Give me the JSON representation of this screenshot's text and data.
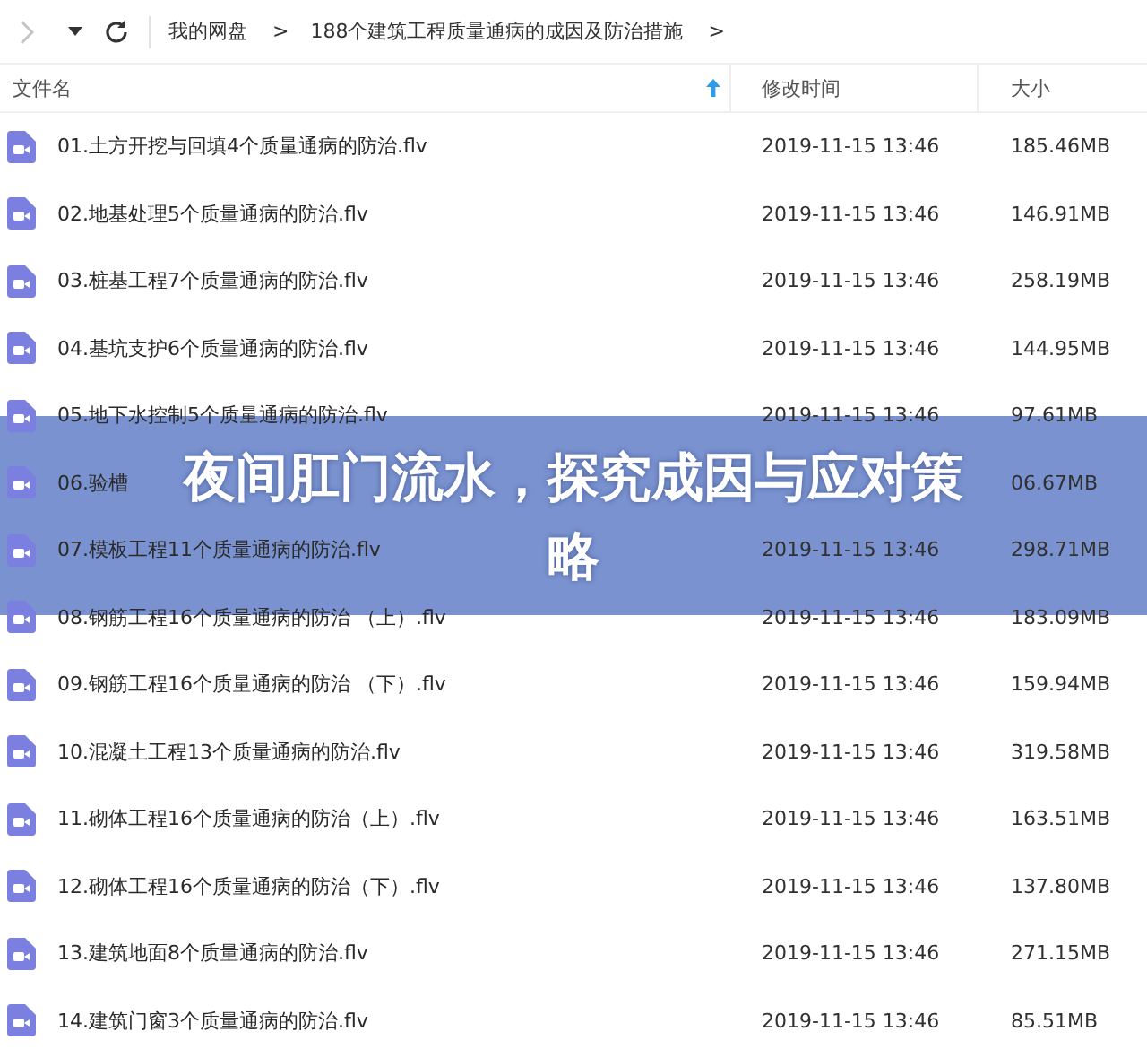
{
  "breadcrumb": [
    {
      "label": "我的网盘",
      "separator": ">"
    },
    {
      "label": "188个建筑工程质量通病的成因及防治措施",
      "separator": ">"
    }
  ],
  "table": {
    "columns": [
      {
        "label": "文件名",
        "sorted": true
      },
      {
        "label": "修改时间",
        "sorted": false
      },
      {
        "label": "大小",
        "sorted": false
      }
    ],
    "rows": [
      {
        "name": "01.土方开挖与回填4个质量通病的防治.flv",
        "modified": "2019-11-15 13:46",
        "size": "185.46MB"
      },
      {
        "name": "02.地基处理5个质量通病的防治.flv",
        "modified": "2019-11-15 13:46",
        "size": "146.91MB"
      },
      {
        "name": "03.桩基工程7个质量通病的防治.flv",
        "modified": "2019-11-15 13:46",
        "size": "258.19MB"
      },
      {
        "name": "04.基坑支护6个质量通病的防治.flv",
        "modified": "2019-11-15 13:46",
        "size": "144.95MB"
      },
      {
        "name": "05.地下水控制5个质量通病的防治.flv",
        "modified": "2019-11-15 13:46",
        "size": "97.61MB"
      },
      {
        "name": "06.验槽",
        "size": "06.67MB"
      },
      {
        "name": "07.模板工程11个质量通病的防治.flv",
        "modified": "2019-11-15 13:46",
        "size": "298.71MB"
      },
      {
        "name": "08.钢筋工程16个质量通病的防治 （上）.flv",
        "modified": "2019-11-15 13:46",
        "size": "183.09MB"
      },
      {
        "name": "09.钢筋工程16个质量通病的防治 （下）.flv",
        "modified": "2019-11-15 13:46",
        "size": "159.94MB"
      },
      {
        "name": "10.混凝土工程13个质量通病的防治.flv",
        "modified": "2019-11-15 13:46",
        "size": "319.58MB"
      },
      {
        "name": "11.砌体工程16个质量通病的防治（上）.flv",
        "modified": "2019-11-15 13:46",
        "size": "163.51MB"
      },
      {
        "name": "12.砌体工程16个质量通病的防治（下）.flv",
        "modified": "2019-11-15 13:46",
        "size": "137.80MB"
      },
      {
        "name": "13.建筑地面8个质量通病的防治.flv",
        "modified": "2019-11-15 13:46",
        "size": "271.15MB"
      },
      {
        "name": "14.建筑门窗3个质量通病的防治.flv",
        "modified": "2019-11-15 13:46",
        "size": "85.51MB"
      }
    ]
  },
  "banner": {
    "lines": [
      "夜间肛门流水，探究成因与应对策",
      "略"
    ]
  }
}
